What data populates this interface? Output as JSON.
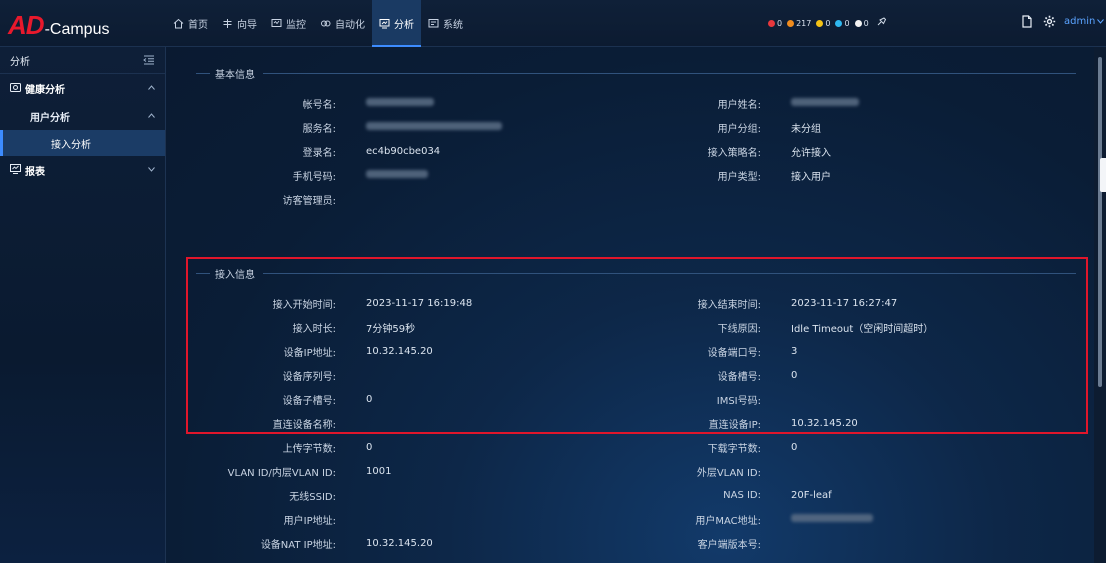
{
  "app": {
    "logo_mark": "AD",
    "logo_text": "-Campus"
  },
  "nav": {
    "items": [
      {
        "label": "首页",
        "icon": "home-icon",
        "active": false
      },
      {
        "label": "向导",
        "icon": "guide-icon",
        "active": false
      },
      {
        "label": "监控",
        "icon": "monitor-icon",
        "active": false
      },
      {
        "label": "自动化",
        "icon": "automation-icon",
        "active": false
      },
      {
        "label": "分析",
        "icon": "analysis-icon",
        "active": true
      },
      {
        "label": "系统",
        "icon": "system-icon",
        "active": false
      }
    ]
  },
  "alarms": [
    {
      "color": "#e8383d",
      "count": "0"
    },
    {
      "color": "#f08c1e",
      "count": "217"
    },
    {
      "color": "#f4c316",
      "count": "0"
    },
    {
      "color": "#2fb8f0",
      "count": "0"
    },
    {
      "color": "#f2f2f2",
      "count": "0"
    }
  ],
  "header_tools": {
    "user_label": "admin"
  },
  "sidebar": {
    "title": "分析",
    "groups": [
      {
        "label": "健康分析",
        "icon": "health-icon",
        "expanded": true
      },
      {
        "label": "报表",
        "icon": "report-icon",
        "expanded": false
      }
    ],
    "sub_label": "用户分析",
    "leaf_label": "接入分析"
  },
  "basic_info": {
    "title": "基本信息",
    "left": [
      {
        "label": "帐号名:",
        "value": "",
        "blurred": true
      },
      {
        "label": "服务名:",
        "value": "",
        "blurred": true
      },
      {
        "label": "登录名:",
        "value": "ec4b90cbe034",
        "blurred_prefix": true
      },
      {
        "label": "手机号码:",
        "value": "",
        "blurred": true
      },
      {
        "label": "访客管理员:",
        "value": ""
      }
    ],
    "right": [
      {
        "label": "用户姓名:",
        "value": "",
        "blurred": true
      },
      {
        "label": "用户分组:",
        "value": "未分组"
      },
      {
        "label": "接入策略名:",
        "value": "允许接入"
      },
      {
        "label": "用户类型:",
        "value": "接入用户"
      }
    ]
  },
  "access_info": {
    "title": "接入信息",
    "left": [
      {
        "label": "接入开始时间:",
        "value": "2023-11-17 16:19:48"
      },
      {
        "label": "接入时长:",
        "value": "7分钟59秒"
      },
      {
        "label": "设备IP地址:",
        "value": "10.32.145.20"
      },
      {
        "label": "设备序列号:",
        "value": ""
      },
      {
        "label": "设备子槽号:",
        "value": "0"
      },
      {
        "label": "直连设备名称:",
        "value": ""
      }
    ],
    "right": [
      {
        "label": "接入结束时间:",
        "value": "2023-11-17 16:27:47"
      },
      {
        "label": "下线原因:",
        "value": "Idle Timeout（空闲时间超时）"
      },
      {
        "label": "设备端口号:",
        "value": "3"
      },
      {
        "label": "设备槽号:",
        "value": "0"
      },
      {
        "label": "IMSI号码:",
        "value": ""
      },
      {
        "label": "直连设备IP:",
        "value": "10.32.145.20"
      }
    ]
  },
  "extra_info": {
    "left": [
      {
        "label": "上传字节数:",
        "value": "0"
      },
      {
        "label": "VLAN ID/内层VLAN ID:",
        "value": "1001"
      },
      {
        "label": "无线SSID:",
        "value": ""
      },
      {
        "label": "用户IP地址:",
        "value": ""
      },
      {
        "label": "设备NAT IP地址:",
        "value": "10.32.145.20"
      }
    ],
    "right": [
      {
        "label": "下载字节数:",
        "value": "0"
      },
      {
        "label": "外层VLAN ID:",
        "value": ""
      },
      {
        "label": "NAS ID:",
        "value": "20F-leaf"
      },
      {
        "label": "用户MAC地址:",
        "value": "",
        "blurred": true
      },
      {
        "label": "客户端版本号:",
        "value": ""
      }
    ]
  }
}
